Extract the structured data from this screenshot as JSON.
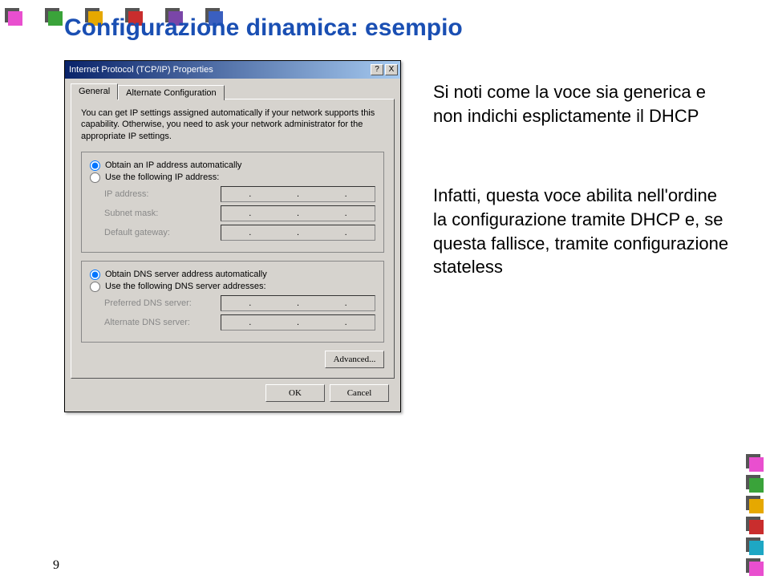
{
  "page": {
    "title": "Configurazione dinamica: esempio",
    "number": "9"
  },
  "squares": {
    "top_colors": [
      "#e94fcf",
      "#3aa33a",
      "#e6a800",
      "#c92d2d",
      "#7a46a8",
      "#3a5fbf"
    ],
    "bottom_colors": [
      "#e94fcf",
      "#3aa33a",
      "#e6a800",
      "#c92d2d",
      "#1ea7c4",
      "#e94fcf"
    ]
  },
  "dialog": {
    "title": "Internet Protocol (TCP/IP) Properties",
    "help_char": "?",
    "close_char": "X",
    "tabs": {
      "general": "General",
      "alternate": "Alternate Configuration"
    },
    "intro": "You can get IP settings assigned automatically if your network supports this capability. Otherwise, you need to ask your network administrator for the appropriate IP settings.",
    "radios": {
      "obtain_ip": "Obtain an IP address automatically",
      "use_ip": "Use the following IP address:",
      "obtain_dns": "Obtain DNS server address automatically",
      "use_dns": "Use the following DNS server addresses:"
    },
    "fields": {
      "ip_address": "IP address:",
      "subnet_mask": "Subnet mask:",
      "default_gateway": "Default gateway:",
      "preferred_dns": "Preferred DNS server:",
      "alternate_dns": "Alternate DNS server:"
    },
    "buttons": {
      "advanced": "Advanced...",
      "ok": "OK",
      "cancel": "Cancel"
    }
  },
  "annotations": {
    "a1": "Si noti come la voce sia generica e non indichi esplictamente il DHCP",
    "a2": "Infatti, questa voce abilita nell'ordine la configurazione tramite DHCP e, se questa fallisce, tramite configurazione stateless"
  }
}
